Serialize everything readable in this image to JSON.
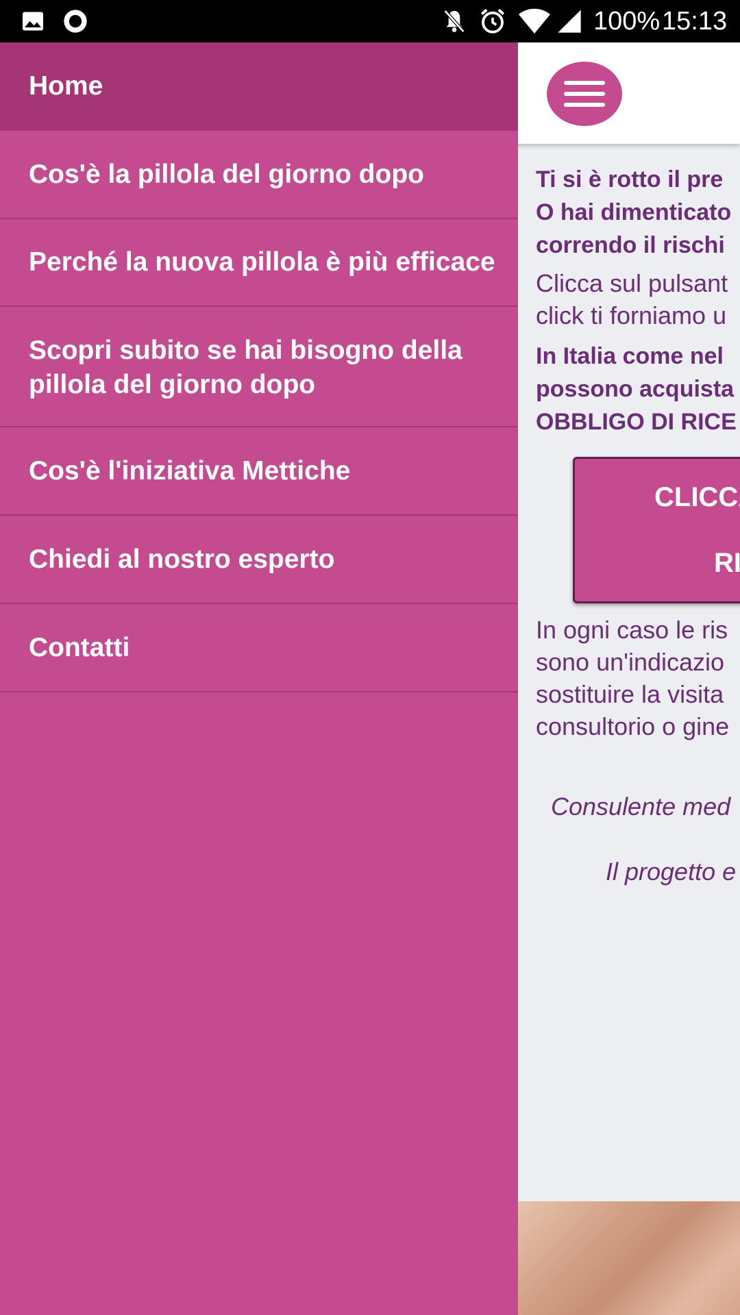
{
  "status_bar": {
    "battery": "100%",
    "time": "15:13",
    "icons": [
      "image-icon",
      "record-icon",
      "notifications-off-icon",
      "alarm-icon",
      "wifi-icon",
      "signal-icon"
    ]
  },
  "drawer": {
    "items": [
      {
        "label": "Home",
        "active": true
      },
      {
        "label": "Cos'è la pillola del giorno dopo"
      },
      {
        "label": "Perché la nuova pillola è più efficace"
      },
      {
        "label": "Scopri subito se hai bisogno della\npillola del giorno dopo"
      },
      {
        "label": "Cos'è l'iniziativa Mettiche"
      },
      {
        "label": "Chiedi al nostro esperto"
      },
      {
        "label": "Contatti"
      }
    ]
  },
  "page": {
    "p1": "Ti si è rotto il pre\nO hai dimenticato\ncorrendo il rischi",
    "p2": "Clicca sul pulsant\nclick ti forniamo u",
    "p3": "In Italia come nel\npossono acquista\nOBBLIGO DI RICE",
    "cta_line1": "CLICCA",
    "cta_line2": "RI",
    "p4": "In ogni caso le ris\nsono un'indicazio\nsostituire la visita\nconsultorio o gine",
    "italic1": "Consulente med",
    "italic2": "Il progetto e"
  },
  "colors": {
    "drawer": "#c44b8f",
    "drawer_active": "#a53574",
    "text_purple": "#6b2d78",
    "page_bg": "#eceef1"
  }
}
